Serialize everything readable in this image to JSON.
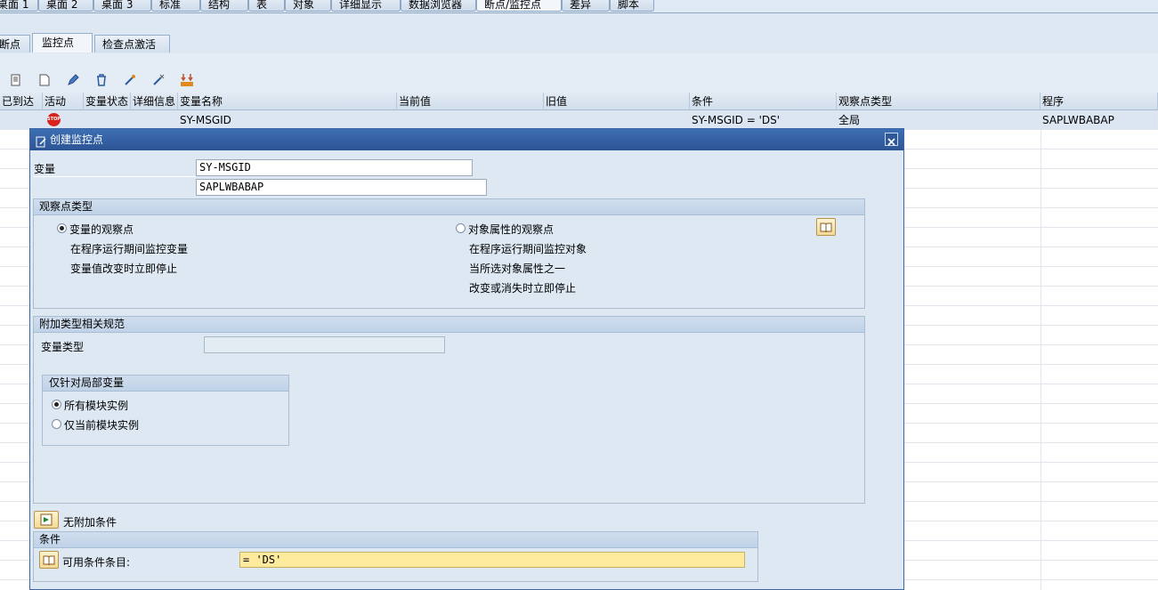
{
  "top_tabs": [
    "桌面 1",
    "桌面 2",
    "桌面 3",
    "标准",
    "结构",
    "表",
    "对象",
    "详细显示",
    "数据浏览器",
    "断点/监控点",
    "差异",
    "脚本"
  ],
  "sub_tabs": [
    "断点",
    "监控点",
    "检查点激活"
  ],
  "table": {
    "headers": [
      "已到达",
      "活动",
      "变量状态",
      "详细信息",
      "变量名称",
      "当前值",
      "旧值",
      "条件",
      "观察点类型",
      "程序"
    ],
    "rows": [
      {
        "reached": "",
        "active_icon": "stop-icon",
        "status": "",
        "details": "",
        "variable": "SY-MSGID",
        "current": "",
        "old": "",
        "condition": "SY-MSGID = 'DS'",
        "type": "全局",
        "program": "SAPLWBABAP"
      }
    ]
  },
  "dialog": {
    "title": "创建监控点",
    "variable_label": "变量",
    "variable_value": "SY-MSGID",
    "program_value": "SAPLWBABAP",
    "watch_type": {
      "header": "观察点类型",
      "opt1_label": "变量的观察点",
      "opt1_desc1": "在程序运行期间监控变量",
      "opt1_desc2": "变量值改变时立即停止",
      "opt2_label": "对象属性的观察点",
      "opt2_desc1": "在程序运行期间监控对象",
      "opt2_desc2": "当所选对象属性之一",
      "opt2_desc3": "改变或消失时立即停止"
    },
    "additional": {
      "header": "附加类型相关规范",
      "var_type_label": "变量类型",
      "var_type_value": "",
      "local_header": "仅针对局部变量",
      "local_opt1": "所有模块实例",
      "local_opt2": "仅当前模块实例"
    },
    "no_condition_label": "无附加条件",
    "condition": {
      "header": "条件",
      "label": "可用条件条目:",
      "value": "= 'DS'"
    }
  }
}
